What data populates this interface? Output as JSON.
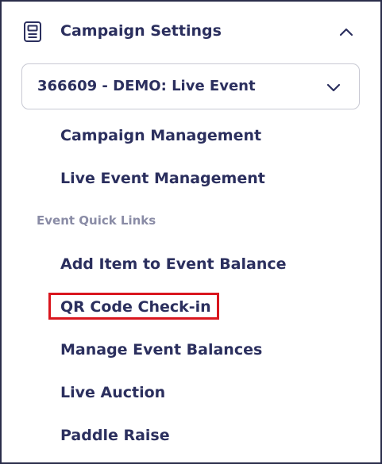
{
  "section": {
    "title": "Campaign Settings",
    "icon": "document-icon",
    "collapse_icon": "chevron-up-icon"
  },
  "campaign_select": {
    "value": "366609 - DEMO: Live Event",
    "icon": "chevron-down-icon"
  },
  "links": {
    "campaign_management": "Campaign Management",
    "live_event_management": "Live Event Management"
  },
  "quick_links": {
    "heading": "Event Quick Links",
    "items": [
      "Add Item to Event Balance",
      "QR Code Check-in",
      "Manage Event Balances",
      "Live Auction",
      "Paddle Raise"
    ]
  },
  "colors": {
    "text": "#2b2f5e",
    "muted": "#8a8ca6",
    "highlight": "#d9161e",
    "border": "#2a2d4a"
  }
}
